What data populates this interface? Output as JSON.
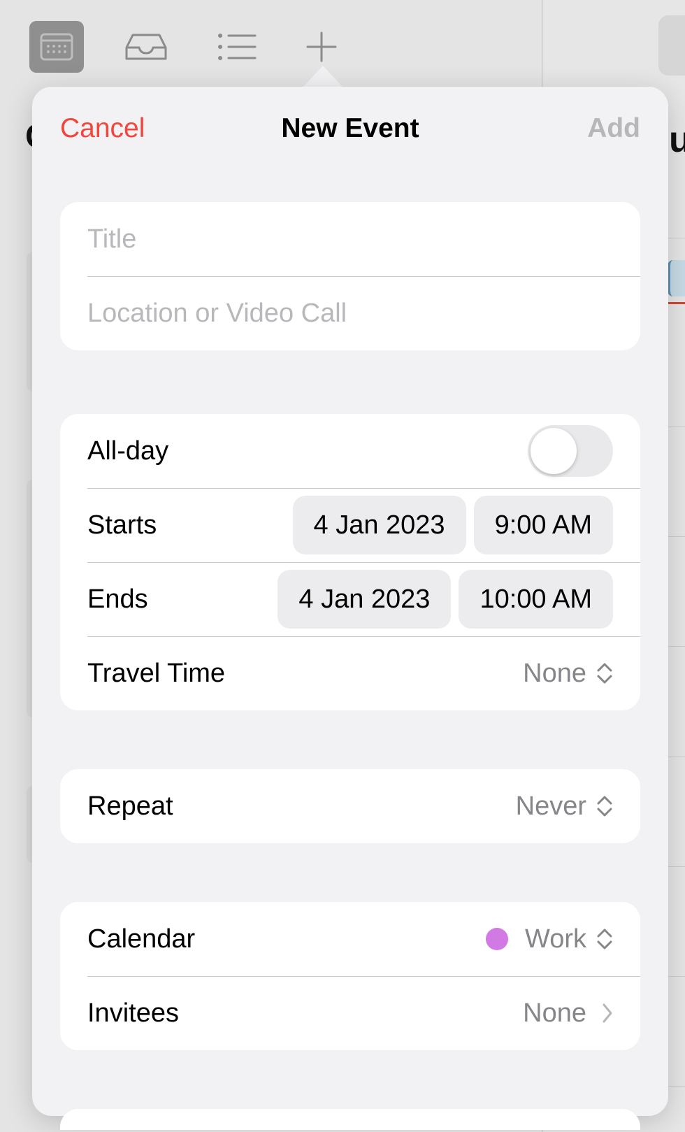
{
  "form": {
    "cancel_label": "Cancel",
    "title": "New Event",
    "add_label": "Add",
    "title_placeholder": "Title",
    "location_placeholder": "Location or Video Call",
    "allday_label": "All-day",
    "allday_on": false,
    "starts_label": "Starts",
    "starts_date": "4 Jan 2023",
    "starts_time": "9:00 AM",
    "ends_label": "Ends",
    "ends_date": "4 Jan 2023",
    "ends_time": "10:00 AM",
    "travel_label": "Travel Time",
    "travel_value": "None",
    "repeat_label": "Repeat",
    "repeat_value": "Never",
    "calendar_label": "Calendar",
    "calendar_value": "Work",
    "calendar_color": "#d17ae3",
    "invitees_label": "Invitees",
    "invitees_value": "None"
  },
  "toolbar": {
    "icons": [
      "calendar-icon",
      "inbox-icon",
      "list-icon",
      "plus-icon"
    ],
    "selected": "calendar-icon"
  },
  "colors": {
    "accent_red": "#f2453b",
    "secondary_text": "#86868a",
    "disabled_text": "#b7b7b9"
  }
}
